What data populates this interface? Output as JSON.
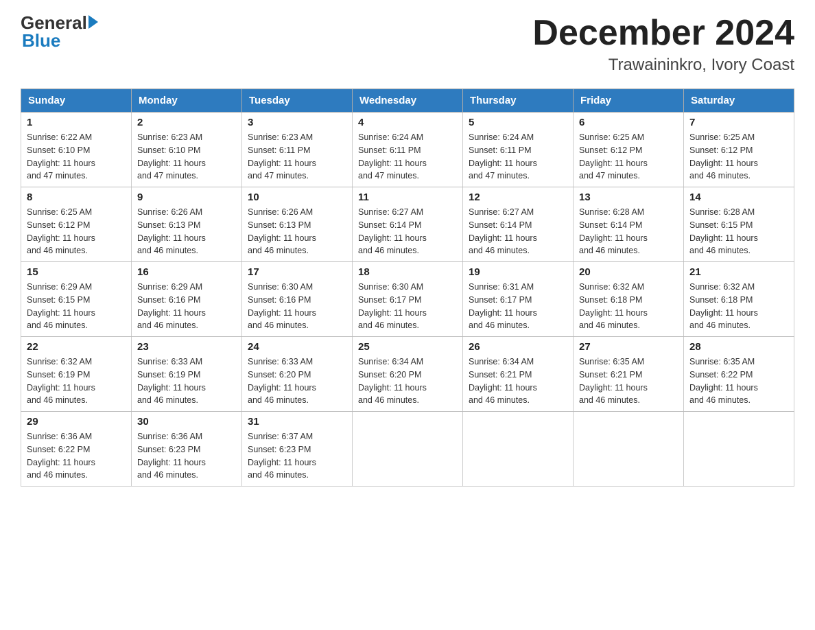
{
  "header": {
    "logo_general": "General",
    "logo_blue": "Blue",
    "month_title": "December 2024",
    "location": "Trawaininkro, Ivory Coast"
  },
  "weekdays": [
    "Sunday",
    "Monday",
    "Tuesday",
    "Wednesday",
    "Thursday",
    "Friday",
    "Saturday"
  ],
  "weeks": [
    [
      {
        "day": "1",
        "sunrise": "6:22 AM",
        "sunset": "6:10 PM",
        "daylight": "11 hours and 47 minutes."
      },
      {
        "day": "2",
        "sunrise": "6:23 AM",
        "sunset": "6:10 PM",
        "daylight": "11 hours and 47 minutes."
      },
      {
        "day": "3",
        "sunrise": "6:23 AM",
        "sunset": "6:11 PM",
        "daylight": "11 hours and 47 minutes."
      },
      {
        "day": "4",
        "sunrise": "6:24 AM",
        "sunset": "6:11 PM",
        "daylight": "11 hours and 47 minutes."
      },
      {
        "day": "5",
        "sunrise": "6:24 AM",
        "sunset": "6:11 PM",
        "daylight": "11 hours and 47 minutes."
      },
      {
        "day": "6",
        "sunrise": "6:25 AM",
        "sunset": "6:12 PM",
        "daylight": "11 hours and 47 minutes."
      },
      {
        "day": "7",
        "sunrise": "6:25 AM",
        "sunset": "6:12 PM",
        "daylight": "11 hours and 46 minutes."
      }
    ],
    [
      {
        "day": "8",
        "sunrise": "6:25 AM",
        "sunset": "6:12 PM",
        "daylight": "11 hours and 46 minutes."
      },
      {
        "day": "9",
        "sunrise": "6:26 AM",
        "sunset": "6:13 PM",
        "daylight": "11 hours and 46 minutes."
      },
      {
        "day": "10",
        "sunrise": "6:26 AM",
        "sunset": "6:13 PM",
        "daylight": "11 hours and 46 minutes."
      },
      {
        "day": "11",
        "sunrise": "6:27 AM",
        "sunset": "6:14 PM",
        "daylight": "11 hours and 46 minutes."
      },
      {
        "day": "12",
        "sunrise": "6:27 AM",
        "sunset": "6:14 PM",
        "daylight": "11 hours and 46 minutes."
      },
      {
        "day": "13",
        "sunrise": "6:28 AM",
        "sunset": "6:14 PM",
        "daylight": "11 hours and 46 minutes."
      },
      {
        "day": "14",
        "sunrise": "6:28 AM",
        "sunset": "6:15 PM",
        "daylight": "11 hours and 46 minutes."
      }
    ],
    [
      {
        "day": "15",
        "sunrise": "6:29 AM",
        "sunset": "6:15 PM",
        "daylight": "11 hours and 46 minutes."
      },
      {
        "day": "16",
        "sunrise": "6:29 AM",
        "sunset": "6:16 PM",
        "daylight": "11 hours and 46 minutes."
      },
      {
        "day": "17",
        "sunrise": "6:30 AM",
        "sunset": "6:16 PM",
        "daylight": "11 hours and 46 minutes."
      },
      {
        "day": "18",
        "sunrise": "6:30 AM",
        "sunset": "6:17 PM",
        "daylight": "11 hours and 46 minutes."
      },
      {
        "day": "19",
        "sunrise": "6:31 AM",
        "sunset": "6:17 PM",
        "daylight": "11 hours and 46 minutes."
      },
      {
        "day": "20",
        "sunrise": "6:32 AM",
        "sunset": "6:18 PM",
        "daylight": "11 hours and 46 minutes."
      },
      {
        "day": "21",
        "sunrise": "6:32 AM",
        "sunset": "6:18 PM",
        "daylight": "11 hours and 46 minutes."
      }
    ],
    [
      {
        "day": "22",
        "sunrise": "6:32 AM",
        "sunset": "6:19 PM",
        "daylight": "11 hours and 46 minutes."
      },
      {
        "day": "23",
        "sunrise": "6:33 AM",
        "sunset": "6:19 PM",
        "daylight": "11 hours and 46 minutes."
      },
      {
        "day": "24",
        "sunrise": "6:33 AM",
        "sunset": "6:20 PM",
        "daylight": "11 hours and 46 minutes."
      },
      {
        "day": "25",
        "sunrise": "6:34 AM",
        "sunset": "6:20 PM",
        "daylight": "11 hours and 46 minutes."
      },
      {
        "day": "26",
        "sunrise": "6:34 AM",
        "sunset": "6:21 PM",
        "daylight": "11 hours and 46 minutes."
      },
      {
        "day": "27",
        "sunrise": "6:35 AM",
        "sunset": "6:21 PM",
        "daylight": "11 hours and 46 minutes."
      },
      {
        "day": "28",
        "sunrise": "6:35 AM",
        "sunset": "6:22 PM",
        "daylight": "11 hours and 46 minutes."
      }
    ],
    [
      {
        "day": "29",
        "sunrise": "6:36 AM",
        "sunset": "6:22 PM",
        "daylight": "11 hours and 46 minutes."
      },
      {
        "day": "30",
        "sunrise": "6:36 AM",
        "sunset": "6:23 PM",
        "daylight": "11 hours and 46 minutes."
      },
      {
        "day": "31",
        "sunrise": "6:37 AM",
        "sunset": "6:23 PM",
        "daylight": "11 hours and 46 minutes."
      },
      null,
      null,
      null,
      null
    ]
  ],
  "labels": {
    "sunrise": "Sunrise:",
    "sunset": "Sunset:",
    "daylight": "Daylight:"
  }
}
